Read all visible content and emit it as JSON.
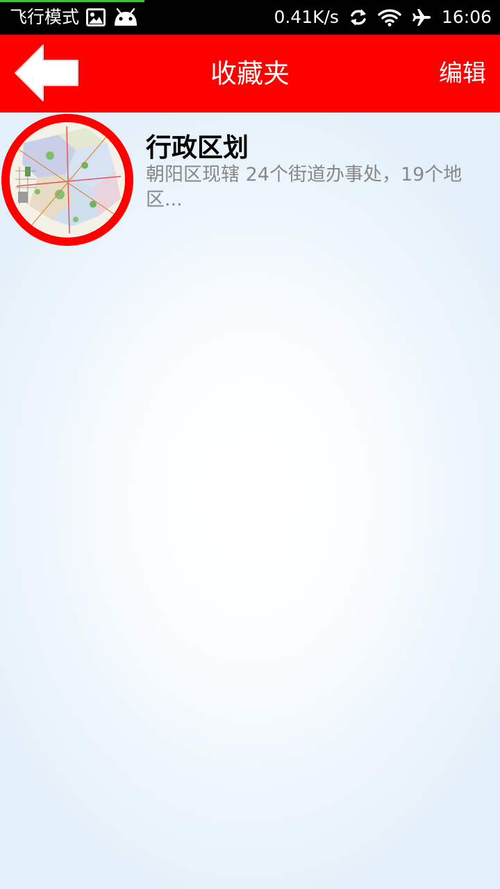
{
  "status_bar": {
    "mode_text": "飞行模式",
    "net_speed": "0.41K/s",
    "time": "16:06",
    "icons": [
      "image-icon",
      "android-icon",
      "sync-icon",
      "wifi-icon",
      "airplane-icon"
    ]
  },
  "header": {
    "title": "收藏夹",
    "edit_label": "编辑",
    "back_icon": "back-arrow-icon",
    "background_color": "#ff0000"
  },
  "favorites": {
    "items": [
      {
        "title": "行政区划",
        "description": "朝阳区现辖 24个街道办事处，19个地区...",
        "thumbnail_icon": "district-map-thumbnail"
      }
    ]
  }
}
